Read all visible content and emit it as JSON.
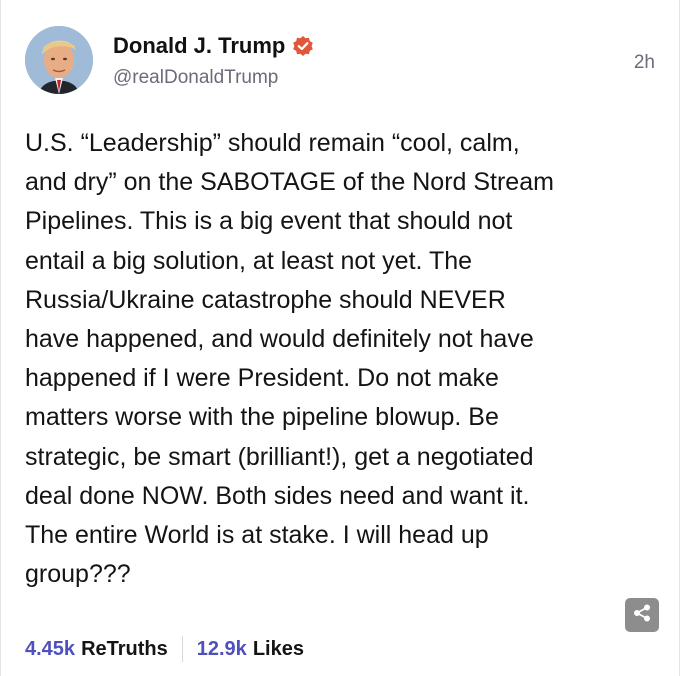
{
  "author": {
    "display_name": "Donald J. Trump",
    "handle": "@realDonaldTrump",
    "verified": true,
    "verified_color": "#e1573c",
    "avatar_icon": "profile-photo"
  },
  "post": {
    "timestamp": "2h",
    "text": "U.S. “Leadership” should remain “cool, calm,\nand dry” on the SABOTAGE of the Nord Stream\nPipelines. This is a big event that should not\nentail a big solution, at least not yet. The\nRussia/Ukraine catastrophe should NEVER\nhave happened, and would definitely not have\nhappened if I were President. Do not make\nmatters worse with the pipeline blowup. Be\nstrategic, be smart (brilliant!), get a negotiated\ndeal done NOW. Both sides need and want it.\nThe entire World is at stake. I will head up\ngroup???"
  },
  "stats": {
    "retruths_count": "4.45k",
    "retruths_label": "ReTruths",
    "likes_count": "12.9k",
    "likes_label": "Likes"
  },
  "colors": {
    "stat_number": "#4f4fbd",
    "text": "#141414",
    "muted": "#6b6b7b",
    "share_bg": "#8d8d8d"
  },
  "icons": {
    "share": "share-icon",
    "verified": "verified-badge-icon"
  }
}
